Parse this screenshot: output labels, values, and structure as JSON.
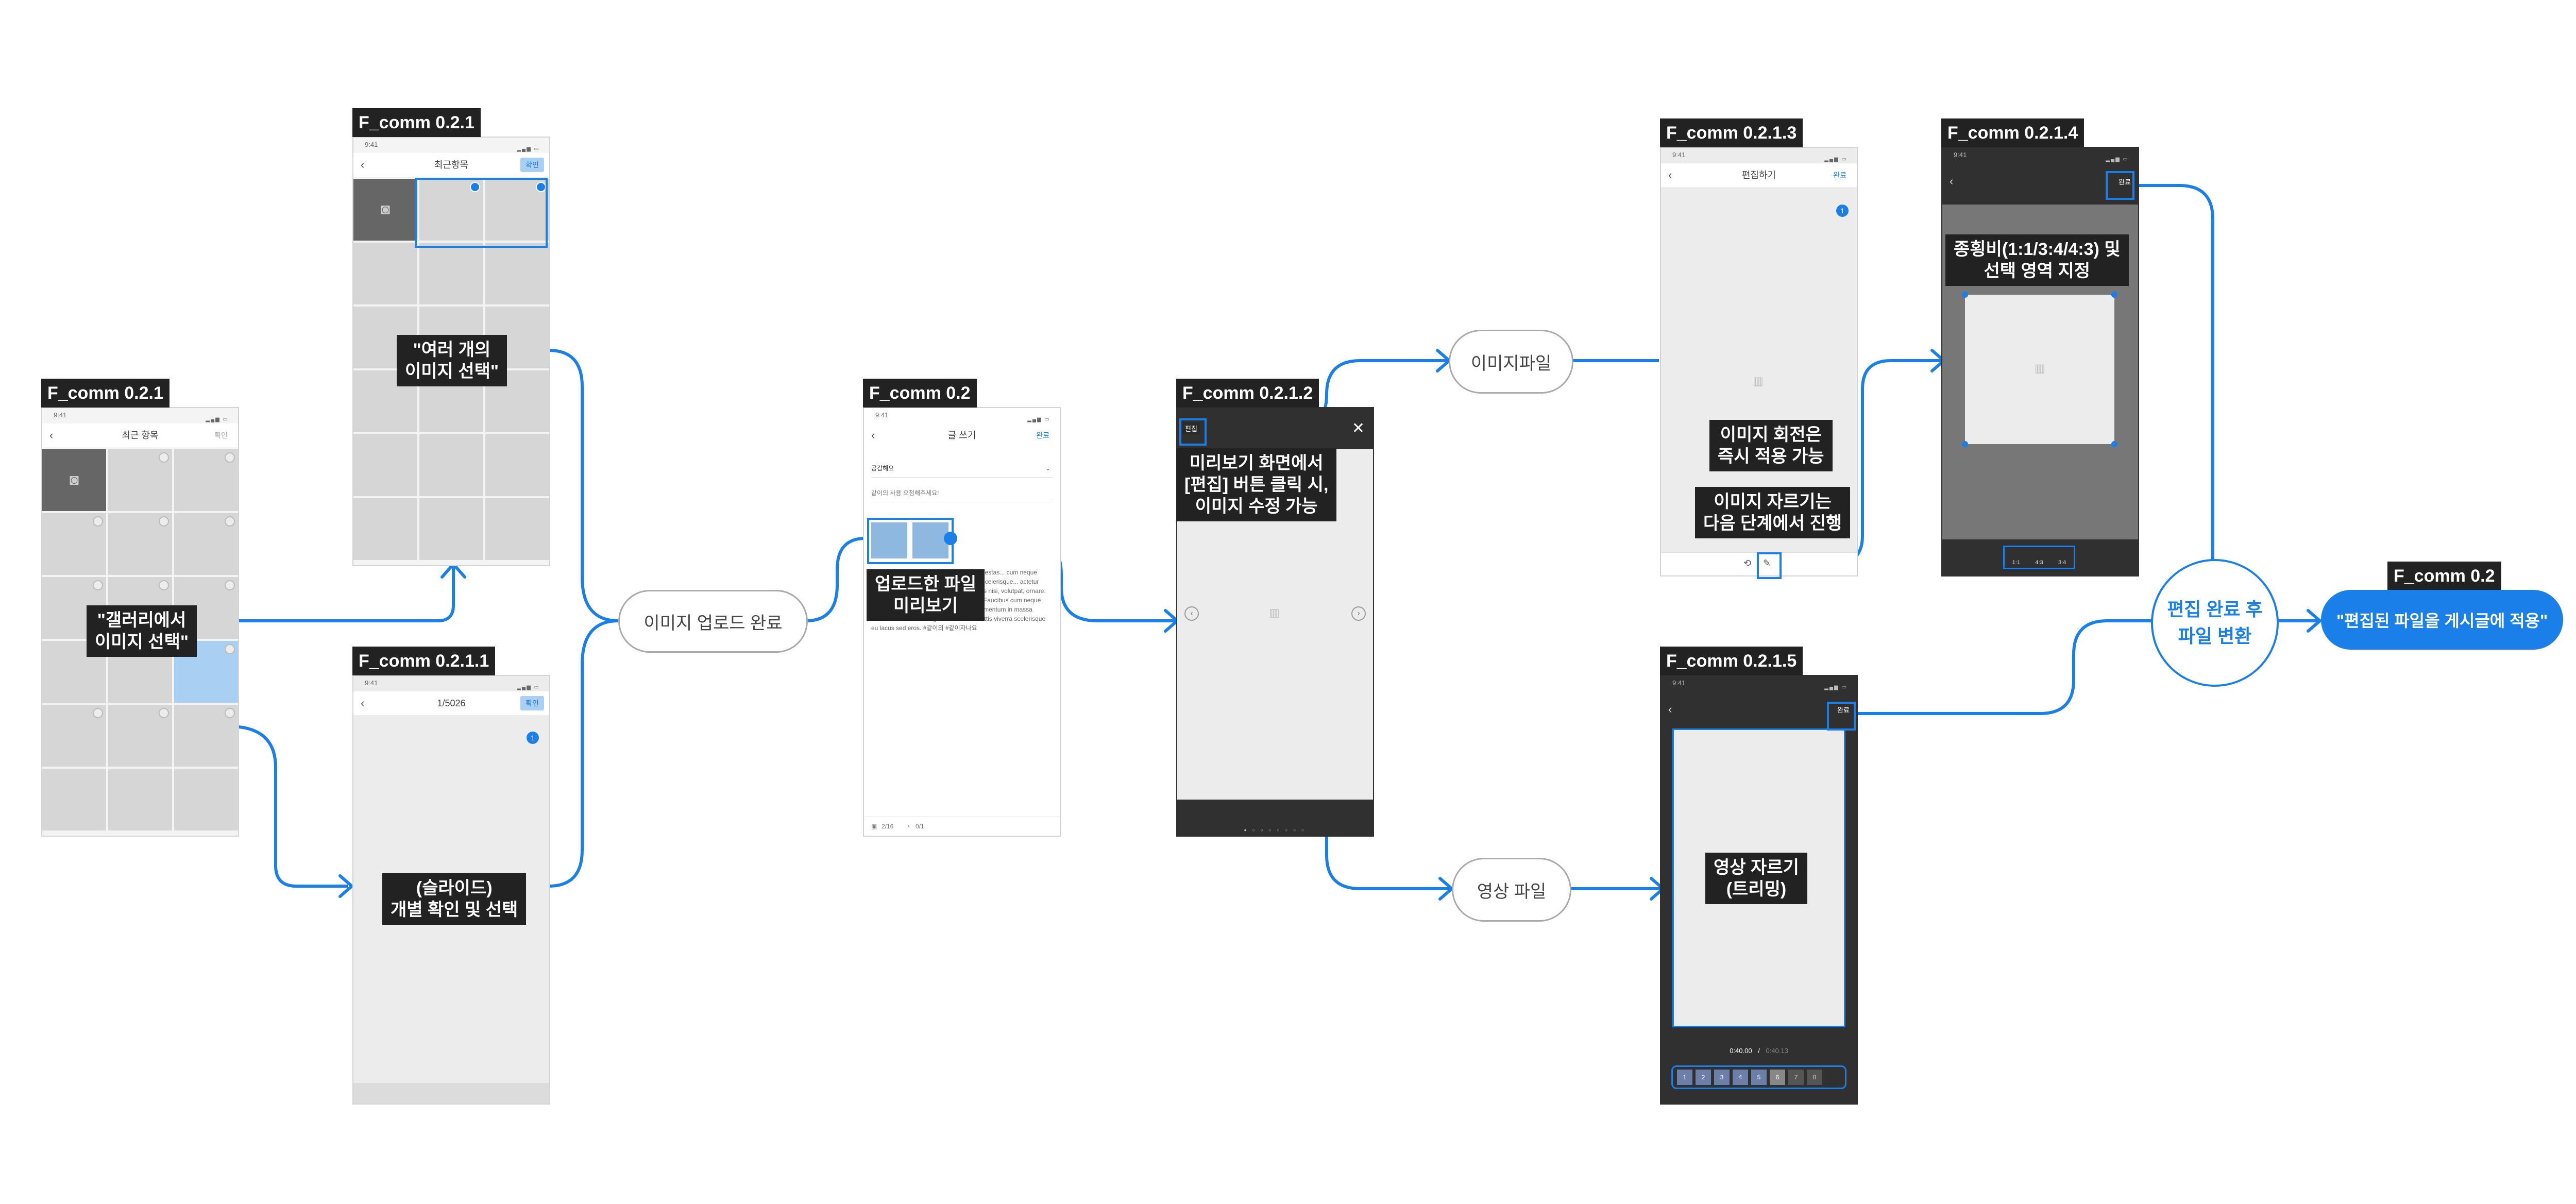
{
  "frames": {
    "f021": {
      "title": "F_comm 0.2.1",
      "time": "9:41",
      "nav_title": "최근 항목",
      "nav_right": "확인",
      "callout": "\"갤러리에서\n이미지 선택\""
    },
    "f021_multi": {
      "title": "F_comm 0.2.1",
      "time": "9:41",
      "nav_title": "최근항목",
      "nav_right": "확인",
      "callout": "\"여러 개의\n이미지 선택\""
    },
    "f0211": {
      "title": "F_comm 0.2.1.1",
      "time": "9:41",
      "nav_title": "1/5026",
      "nav_right": "확인",
      "badge": "1",
      "callout": "(슬라이드)\n개별 확인 및 선택"
    },
    "f02": {
      "title": "F_comm 0.2",
      "time": "9:41",
      "nav_title": "글 쓰기",
      "nav_right": "완료",
      "category": "공감해요",
      "placeholder": "같이의 사용 요청해주세요!",
      "callout": "업로드한 파일\n미리보기",
      "body_text": "...tetur adipiscing elit. Sit... amet, Vitae egestas... cum neque est, sit... entum in massa diam... viverra scelerisque... actetur adipiscing elit. Sit arcu, quis mattis sagittis nisi, volutpat, ornare. Vitae egestas ut tempor egestas in eros. Faucibus cum neque est, sit dignissim dictum in rhonc. Sed fermentum in massa diam non ut viverra. Dignissim blandit mattis viverra scelerisque eu lacus sed eros. #같이의 #같이자나요",
      "footer_left": "2/16",
      "footer_right": "0/1"
    },
    "f0212": {
      "title": "F_comm 0.2.1.2",
      "edit_label": "편집",
      "callout": "미리보기 화면에서\n[편집] 버튼 클릭 시,\n이미지 수정 가능"
    },
    "f0213": {
      "title": "F_comm 0.2.1.3",
      "time": "9:41",
      "nav_title": "편집하기",
      "nav_right": "완료",
      "badge": "1",
      "callout_rotate": "이미지 회전은\n즉시 적용 가능",
      "callout_crop": "이미지 자르기는\n다음 단계에서 진행"
    },
    "f0214": {
      "title": "F_comm 0.2.1.4",
      "time": "9:41",
      "nav_right": "완료",
      "callout": "종횡비(1:1/3:4/4:3) 및\n선택 영역 지정",
      "ratios": [
        "1:1",
        "4:3",
        "3:4"
      ]
    },
    "f0215": {
      "title": "F_comm 0.2.1.5",
      "time": "9:41",
      "nav_right": "완료",
      "callout": "영상 자르기\n(트리밍)",
      "time_current": "0:40.00",
      "time_sep": "/",
      "time_total": "0:40.13",
      "thumbs": [
        "1",
        "2",
        "3",
        "4",
        "5",
        "6",
        "7",
        "8"
      ]
    },
    "f02_final": {
      "title": "F_comm 0.2"
    }
  },
  "nodes": {
    "upload_done": "이미지 업로드 완료",
    "image_file": "이미지파일",
    "video_file": "영상 파일",
    "edit_done": "편집 완료 후\n파일 변환",
    "final": "\"편집된 파일을 게시글에 적용\""
  },
  "icons": {
    "camera": "camera-icon",
    "close": "close-icon",
    "back": "chevron-left-icon",
    "image": "image-placeholder-icon",
    "rotate": "rotate-icon",
    "crop": "crop-icon"
  },
  "colors": {
    "accent": "#1a7fe8",
    "dark": "#222222",
    "selected": "#a9cff3"
  }
}
